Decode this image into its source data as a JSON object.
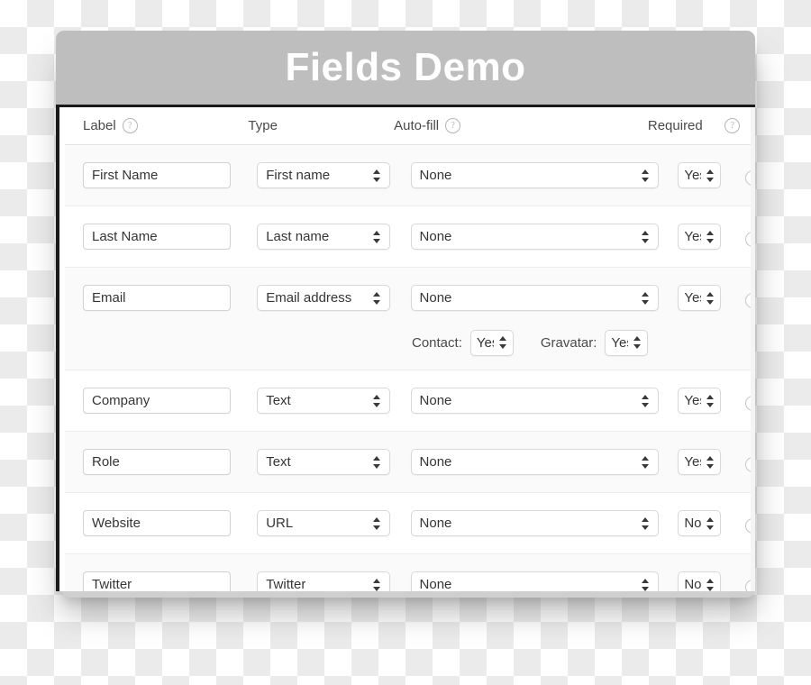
{
  "window": {
    "title": "Fields Demo"
  },
  "table": {
    "headers": [
      {
        "label": "Label",
        "help": true,
        "icon": "help-circle-icon"
      },
      {
        "label": "Type",
        "help": false,
        "icon": ""
      },
      {
        "label": "Auto-fill",
        "help": true,
        "icon": "help-circle-icon"
      },
      {
        "label": "Required",
        "help": false,
        "icon": ""
      }
    ],
    "help_glyph": "?",
    "rows": [
      {
        "label_value": "First Name",
        "type_value": "First name",
        "autofill_value": "None",
        "required_value": "Yes"
      },
      {
        "label_value": "Last Name",
        "type_value": "Last name",
        "autofill_value": "None",
        "required_value": "Yes"
      },
      {
        "label_value": "Email",
        "type_value": "Email address",
        "autofill_value": "None",
        "required_value": "Yes",
        "sub": {
          "contact_label": "Contact:",
          "contact_value": "Yes",
          "gravatar_label": "Gravatar:",
          "gravatar_value": "Yes"
        }
      },
      {
        "label_value": "Company",
        "type_value": "Text",
        "autofill_value": "None",
        "required_value": "Yes"
      },
      {
        "label_value": "Role",
        "type_value": "Text",
        "autofill_value": "None",
        "required_value": "Yes"
      },
      {
        "label_value": "Website",
        "type_value": "URL",
        "autofill_value": "None",
        "required_value": "No"
      },
      {
        "label_value": "Twitter",
        "type_value": "Twitter",
        "autofill_value": "None",
        "required_value": "No"
      }
    ]
  },
  "colors": {
    "titlebar_bg": "#bebebe",
    "titlebar_text": "#ffffff",
    "row_alt_bg": "#fafafa",
    "row_plain_bg": "#ffffff",
    "text": "#353535",
    "muted": "#b4b4b4"
  }
}
